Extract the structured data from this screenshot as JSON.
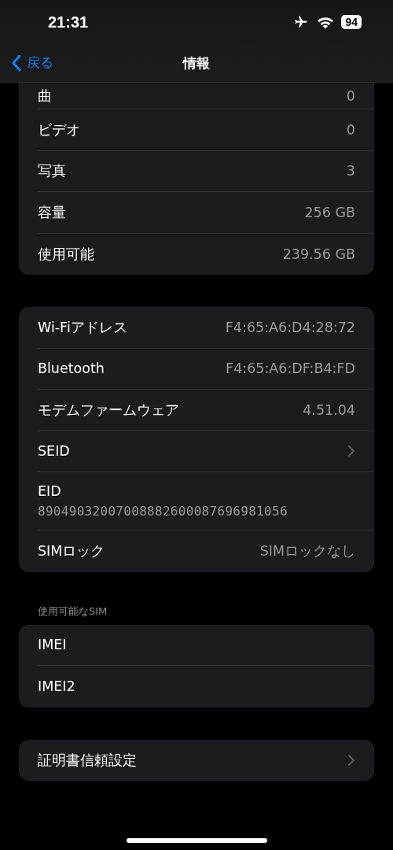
{
  "status_bar": {
    "time": "21:31",
    "battery": "94"
  },
  "nav": {
    "back": "戻る",
    "title": "情報"
  },
  "groups": [
    {
      "rows": [
        {
          "kind": "value",
          "label": "曲",
          "value": "0"
        },
        {
          "kind": "value",
          "label": "ビデオ",
          "value": "0"
        },
        {
          "kind": "value",
          "label": "写真",
          "value": "3"
        },
        {
          "kind": "value",
          "label": "容量",
          "value": "256 GB"
        },
        {
          "kind": "value",
          "label": "使用可能",
          "value": "239.56 GB"
        }
      ]
    },
    {
      "rows": [
        {
          "kind": "value",
          "label": "Wi-Fiアドレス",
          "value": "F4:65:A6:D4:28:72"
        },
        {
          "kind": "value",
          "label": "Bluetooth",
          "value": "F4:65:A6:DF:B4:FD"
        },
        {
          "kind": "value",
          "label": "モデムファームウェア",
          "value": "4.51.04"
        },
        {
          "kind": "chevron",
          "label": "SEID"
        },
        {
          "kind": "stacked",
          "label": "EID",
          "value": "89049032007008882600087696981056"
        },
        {
          "kind": "value",
          "label": "SIMロック",
          "value": "SIMロックなし"
        }
      ]
    },
    {
      "header": "使用可能なSIM",
      "rows": [
        {
          "kind": "plain",
          "label": "IMEI"
        },
        {
          "kind": "plain",
          "label": "IMEI2"
        }
      ]
    },
    {
      "rows": [
        {
          "kind": "chevron",
          "label": "証明書信頼設定"
        }
      ]
    }
  ]
}
